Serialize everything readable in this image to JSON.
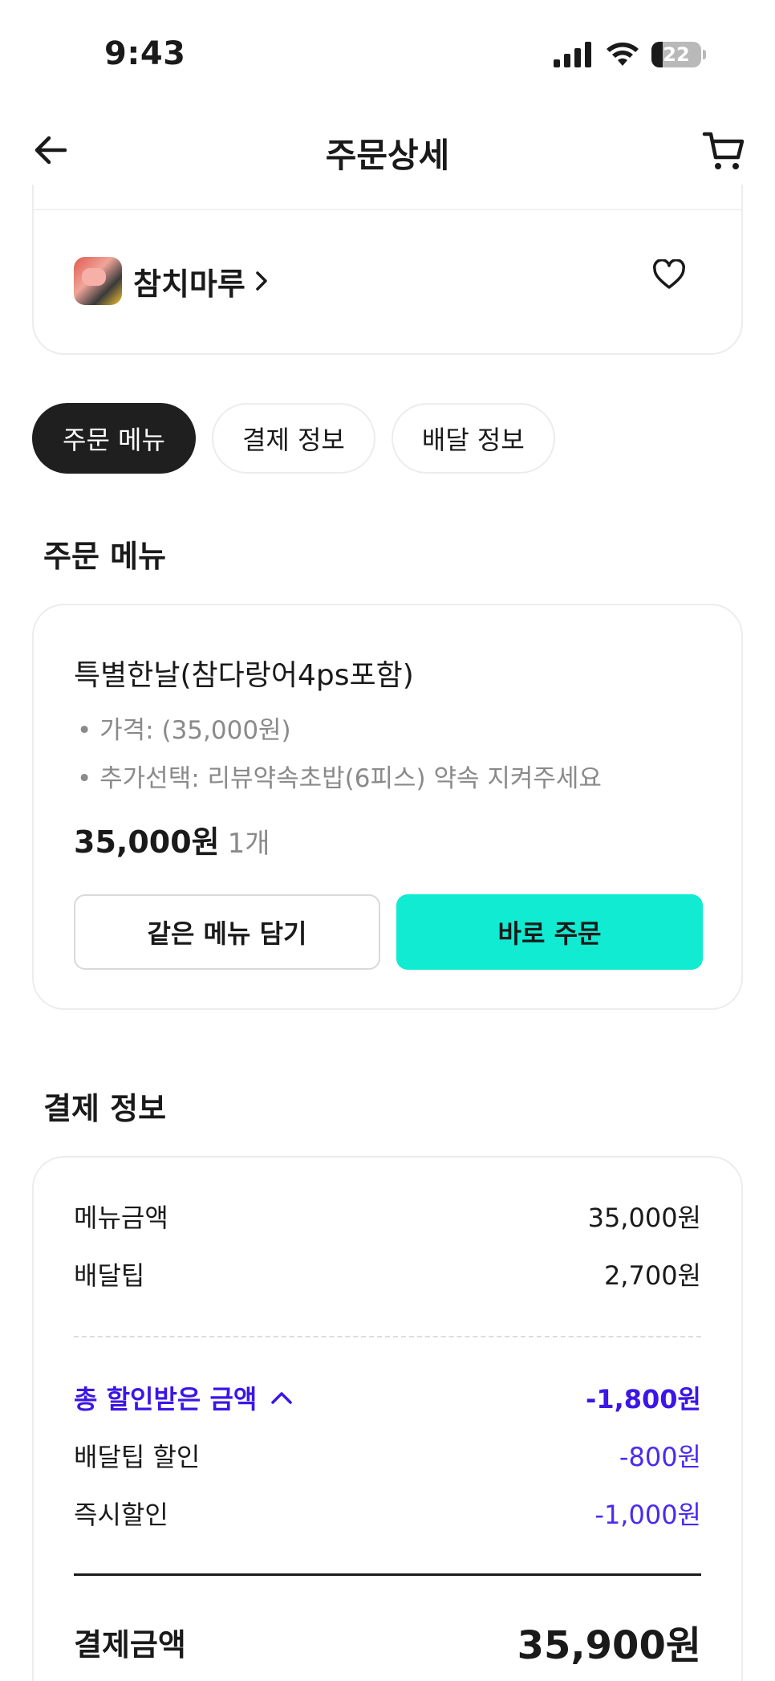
{
  "status": {
    "time": "9:43",
    "battery": "22"
  },
  "nav": {
    "title": "주문상세"
  },
  "store": {
    "name": "참치마루"
  },
  "tabs": [
    "주문 메뉴",
    "결제 정보",
    "배달 정보"
  ],
  "order_menu": {
    "section_title": "주문 메뉴",
    "item_name": "특별한날(참다랑어4ps포함)",
    "options": [
      "• 가격:  (35,000원)",
      "• 추가선택: 리뷰약속초밥(6피스) 약속 지켜주세요"
    ],
    "price": "35,000원",
    "quantity": "1개",
    "add_same_button": "같은 메뉴 담기",
    "order_now_button": "바로 주문"
  },
  "payment": {
    "section_title": "결제 정보",
    "menu_amount_label": "메뉴금액",
    "menu_amount": "35,000원",
    "delivery_tip_label": "배달팁",
    "delivery_tip": "2,700원",
    "discount_total_label": "총 할인받은 금액",
    "discount_total": "-1,800원",
    "delivery_tip_discount_label": "배달팁 할인",
    "delivery_tip_discount": "-800원",
    "instant_discount_label": "즉시할인",
    "instant_discount": "-1,000원",
    "total_label": "결제금액",
    "total": "35,900원"
  },
  "colors": {
    "accent": "#10ebd2",
    "discount": "#3b16e6",
    "active_tab": "#1f1f1f"
  }
}
